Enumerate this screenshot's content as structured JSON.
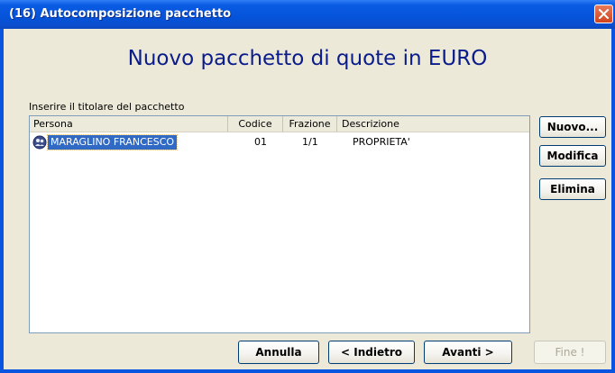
{
  "window": {
    "title": "(16) Autocomposizione pacchetto"
  },
  "heading": "Nuovo pacchetto di quote in EURO",
  "instruction": "Inserire il titolare del pacchetto",
  "table": {
    "columns": [
      "Persona",
      "Codice",
      "Frazione",
      "Descrizione"
    ],
    "rows": [
      {
        "persona": "MARAGLINO FRANCESCO",
        "codice": "01",
        "frazione": "1/1",
        "descrizione": "PROPRIETA'",
        "icon": "person-icon",
        "selected": true
      }
    ]
  },
  "side_buttons": {
    "nuovo": "Nuovo...",
    "modifica": "Modifica",
    "elimina": "Elimina"
  },
  "bottom_buttons": {
    "annulla": "Annulla",
    "indietro": "< Indietro",
    "avanti": "Avanti >",
    "fine": "Fine !"
  },
  "colors": {
    "titlebar": "#0553d9",
    "heading": "#0a1c8c",
    "selection": "#316ac5",
    "close_button": "#d2431c"
  }
}
